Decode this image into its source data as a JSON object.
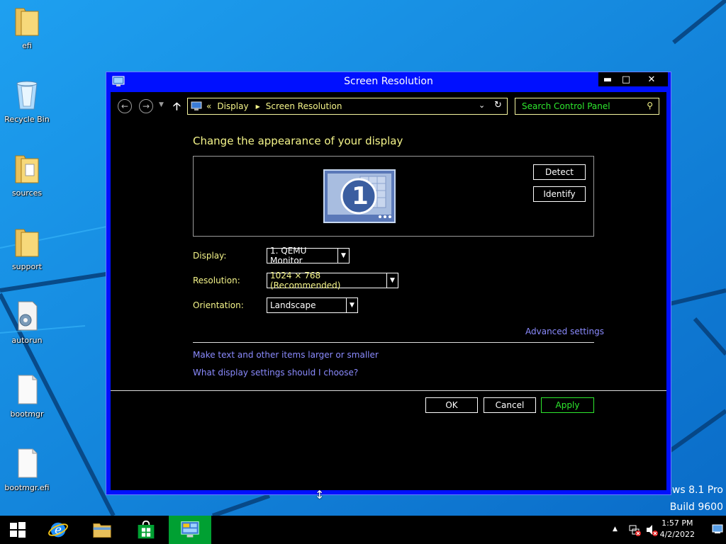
{
  "desktop": {
    "icons": [
      {
        "label": "efi",
        "kind": "folder"
      },
      {
        "label": "Recycle Bin",
        "kind": "recycle-bin"
      },
      {
        "label": "sources",
        "kind": "folder"
      },
      {
        "label": "support",
        "kind": "folder"
      },
      {
        "label": "autorun",
        "kind": "settings-file"
      },
      {
        "label": "bootmgr",
        "kind": "file"
      },
      {
        "label": "bootmgr.efi",
        "kind": "file"
      }
    ],
    "watermark_line1": "ows 8.1 Pro",
    "watermark_line2": "Build 9600"
  },
  "window": {
    "title": "Screen Resolution",
    "controls": {
      "minimize": "▬",
      "maximize": "□",
      "close": "✕"
    },
    "nav": {
      "breadcrumb_prefix": "«",
      "crumb1": "Display",
      "crumb2": "Screen Resolution",
      "search_placeholder": "Search Control Panel"
    },
    "heading": "Change the appearance of your display",
    "monitor_number": "1",
    "detect_label": "Detect",
    "identify_label": "Identify",
    "display_label": "Display:",
    "display_value": "1. QEMU Monitor",
    "resolution_label": "Resolution:",
    "resolution_value": "1024 × 768 (Recommended)",
    "orientation_label": "Orientation:",
    "orientation_value": "Landscape",
    "advanced_link": "Advanced settings",
    "link_text_size": "Make text and other items larger or smaller",
    "link_help": "What display settings should I choose?",
    "ok_label": "OK",
    "cancel_label": "Cancel",
    "apply_label": "Apply"
  },
  "taskbar": {
    "time": "1:57 PM",
    "date": "4/2/2022"
  },
  "colors": {
    "window_frame": "#0010ff",
    "high_contrast_text": "#f5f58a",
    "link": "#8b8bff",
    "apply_green": "#2ee82e",
    "taskbar_active": "#00a032"
  }
}
